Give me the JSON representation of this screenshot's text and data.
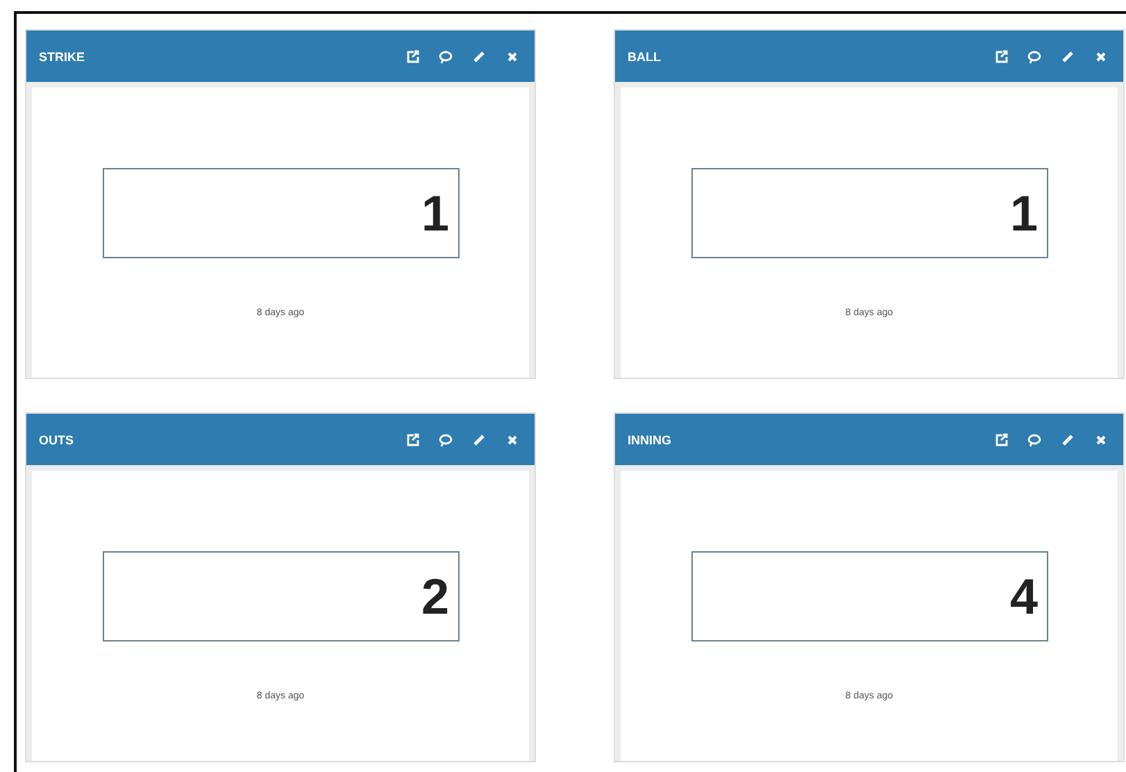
{
  "widgets": [
    {
      "title": "STRIKE",
      "value": "1",
      "updated": "8 days ago"
    },
    {
      "title": "BALL",
      "value": "1",
      "updated": "8 days ago"
    },
    {
      "title": "OUTS",
      "value": "2",
      "updated": "8 days ago"
    },
    {
      "title": "INNING",
      "value": "4",
      "updated": "8 days ago"
    }
  ]
}
